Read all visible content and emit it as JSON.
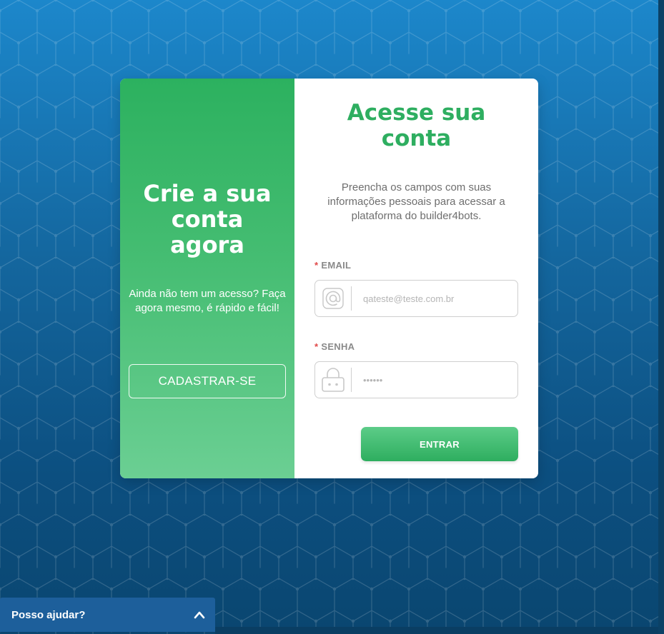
{
  "signup_panel": {
    "title": "Crie a sua conta agora",
    "subtitle": "Ainda não tem um acesso? Faça agora mesmo, é rápido e fácil!",
    "button_label": "CADASTRAR-SE"
  },
  "login_panel": {
    "title": "Acesse sua conta",
    "description": "Preencha os campos com suas informações pessoais para acessar a plataforma do builder4bots.",
    "email": {
      "required_mark": "*",
      "label": "EMAIL",
      "value": "",
      "placeholder": "qateste@teste.com.br",
      "icon": "at-icon"
    },
    "password": {
      "required_mark": "*",
      "label": "SENHA",
      "value": "",
      "placeholder": "••••••",
      "icon": "lock-icon"
    },
    "submit_label": "ENTRAR"
  },
  "help_widget": {
    "label": "Posso ajudar?",
    "icon": "chevron-up-icon"
  },
  "colors": {
    "accent_green": "#2eae60",
    "background_blue": "#1c87cb",
    "help_blue": "#1d5f9b",
    "required_red": "#e04848"
  }
}
